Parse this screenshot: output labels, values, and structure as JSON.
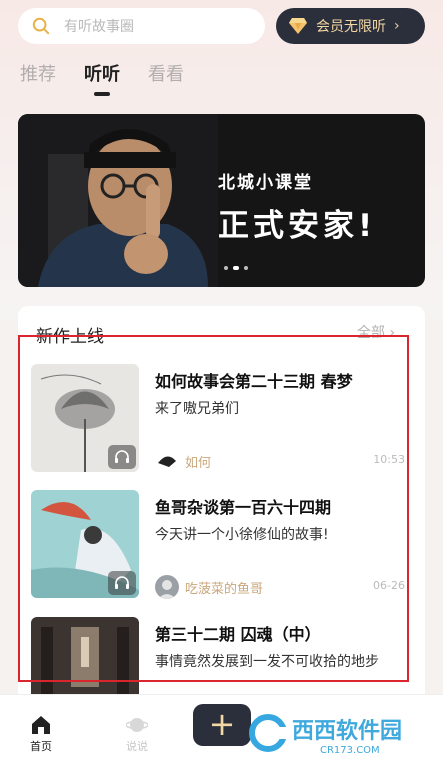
{
  "search": {
    "placeholder": "有听故事圈"
  },
  "vip": {
    "label": "会员无限听"
  },
  "tabs": [
    {
      "label": "推荐"
    },
    {
      "label": "听听"
    },
    {
      "label": "看看"
    }
  ],
  "banner": {
    "subtitle": "北城小课堂",
    "title": "正式安家!"
  },
  "section": {
    "title": "新作上线",
    "more": "全部"
  },
  "items": [
    {
      "title": "如何故事会第二十三期 春梦",
      "desc": "来了嗷兄弟们",
      "author": "如何",
      "time": "10:53"
    },
    {
      "title": "鱼哥杂谈第一百六十四期",
      "desc": "今天讲一个小徐修仙的故事!",
      "author": "吃菠菜的鱼哥",
      "time": "06-26"
    },
    {
      "title": "第三十二期 囚魂（中）",
      "desc": "事情竟然发展到一发不可收拾的地步",
      "author": "",
      "time": ""
    }
  ],
  "nav": [
    {
      "label": "首页"
    },
    {
      "label": "说说"
    }
  ],
  "watermark": {
    "brand": "西西软件园",
    "url": "CR173.COM"
  },
  "colors": {
    "accent_dark": "#2b2f3b",
    "gold": "#f3d7a4",
    "highlight_red": "#d9252b"
  }
}
